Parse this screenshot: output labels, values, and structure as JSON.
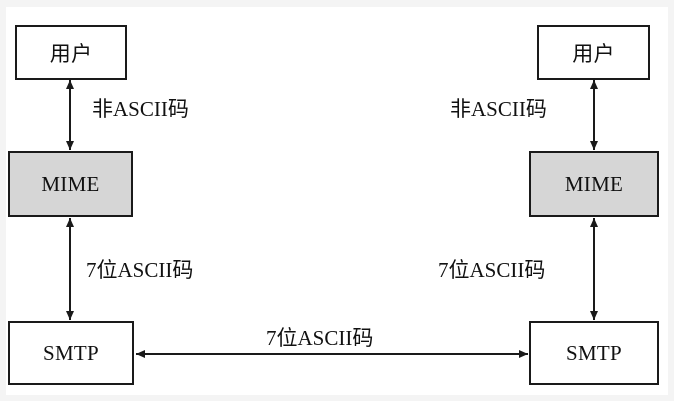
{
  "left": {
    "user": "用户",
    "mime": "MIME",
    "smtp": "SMTP",
    "label_top": "非ASCII码",
    "label_mid": "7位ASCII码"
  },
  "right": {
    "user": "用户",
    "mime": "MIME",
    "smtp": "SMTP",
    "label_top": "非ASCII码",
    "label_mid": "7位ASCII码"
  },
  "link_label": "7位ASCII码",
  "colors": {
    "mime_fill": "#d6d6d6",
    "stroke": "#1a1a1a",
    "background": "#ffffff"
  }
}
